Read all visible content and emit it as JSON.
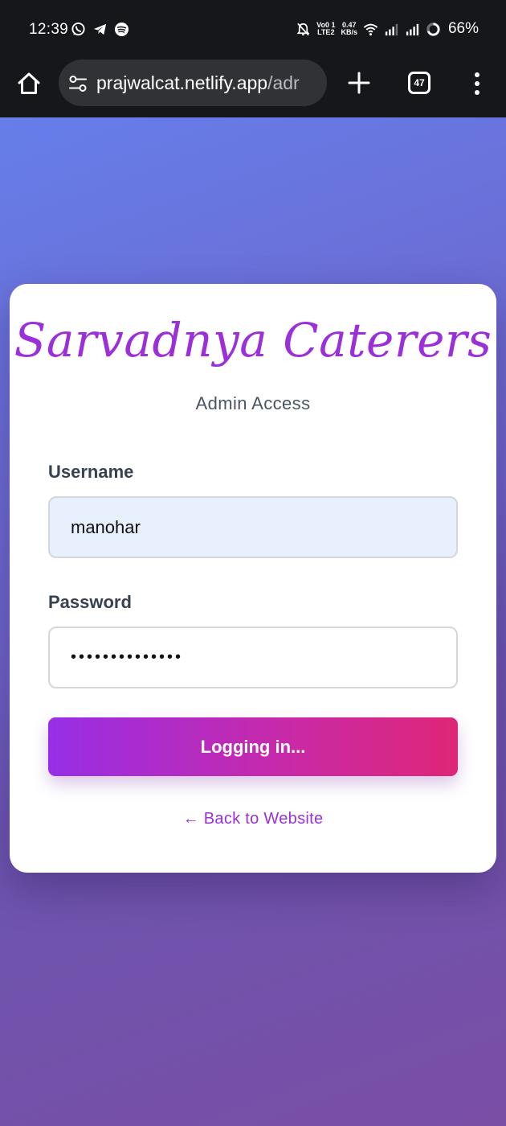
{
  "status_bar": {
    "time": "12:39",
    "icons_left": [
      "whatsapp-icon",
      "telegram-icon",
      "spotify-icon"
    ],
    "icons_right": [
      "bell-off-icon",
      "volte-icon",
      "wifi-icon",
      "signal-icon",
      "signal-icon",
      "battery-ring-icon"
    ],
    "volte_top": "Vo0 1",
    "volte_bottom": "LTE2",
    "speed_top": "0.47",
    "speed_bottom": "KB/s",
    "battery": "66%"
  },
  "browser": {
    "url_host": "prajwalcat.netlify.app",
    "url_path": "/adr",
    "tab_count": "47",
    "icons": [
      "home-icon",
      "site-settings-icon",
      "plus-icon",
      "tabs-icon",
      "more-menu-icon"
    ]
  },
  "card": {
    "brand": "Sarvadnya Caterers",
    "subtitle": "Admin Access",
    "username_label": "Username",
    "username_value": "manohar",
    "password_label": "Password",
    "password_value": "••••••••••••••",
    "login_button": "Logging in...",
    "back_link": "← Back to Website"
  },
  "colors": {
    "accent_purple": "#9b30d9",
    "button_start": "#972ee6",
    "button_end": "#df2677",
    "bg_top": "#667eea",
    "bg_bottom": "#7a4ea5"
  }
}
